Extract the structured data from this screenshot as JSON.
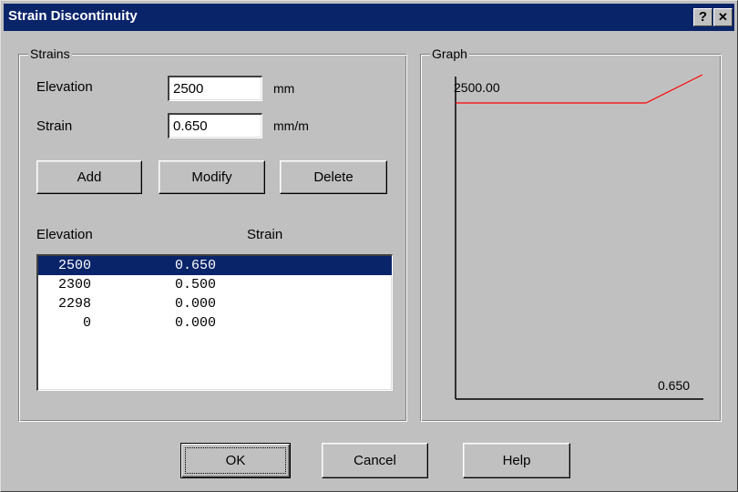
{
  "window": {
    "title": "Strain Discontinuity",
    "help_glyph": "?",
    "close_glyph": "✕"
  },
  "strains_group": {
    "legend": "Strains",
    "elevation_label": "Elevation",
    "elevation_value": "2500",
    "elevation_unit": "mm",
    "strain_label": "Strain",
    "strain_value": "0.650",
    "strain_unit": "mm/m",
    "add_label": "Add",
    "modify_label": "Modify",
    "delete_label": "Delete",
    "col_elevation": "Elevation",
    "col_strain": "Strain",
    "rows": [
      {
        "elevation": "2500",
        "strain": "0.650",
        "selected": true
      },
      {
        "elevation": "2300",
        "strain": "0.500",
        "selected": false
      },
      {
        "elevation": "2298",
        "strain": "0.000",
        "selected": false
      },
      {
        "elevation": "0",
        "strain": "0.000",
        "selected": false
      }
    ]
  },
  "graph_group": {
    "legend": "Graph",
    "top_label": "2500.00",
    "right_label": "0.650",
    "line_color": "#ff0000"
  },
  "footer": {
    "ok_label": "OK",
    "cancel_label": "Cancel",
    "help_label": "Help"
  }
}
